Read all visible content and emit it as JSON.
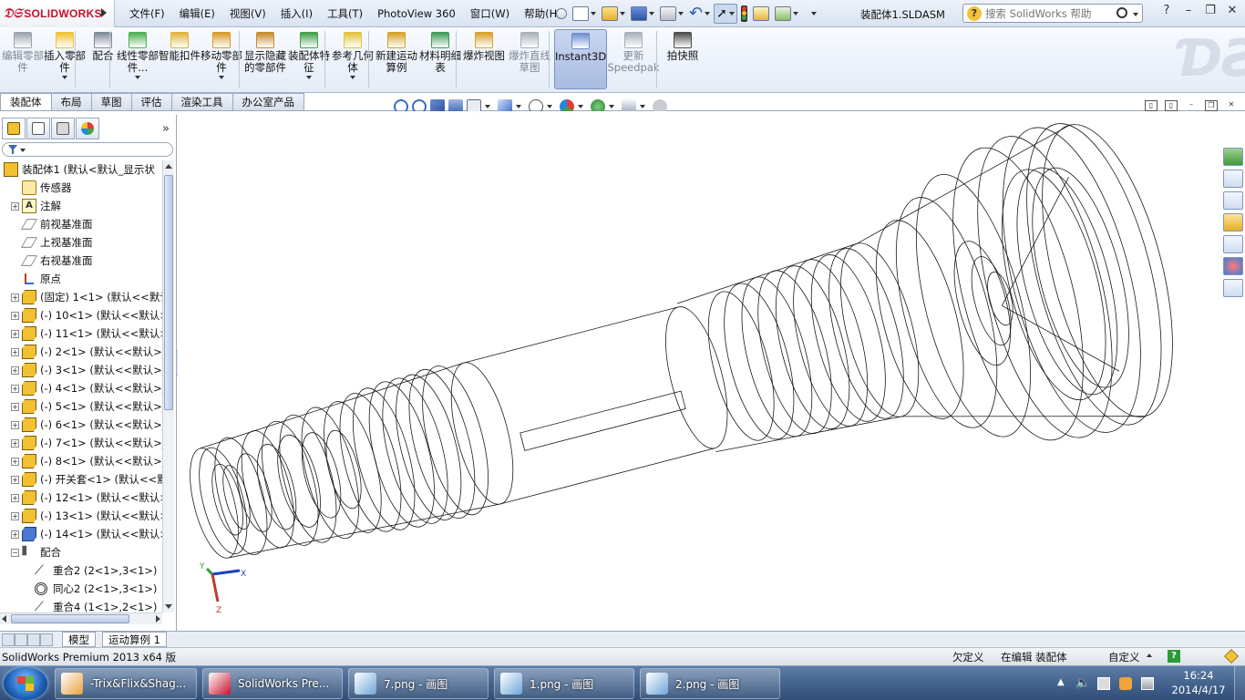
{
  "app": {
    "logo_text": "SOLIDWORKS",
    "doc_title": "装配体1.SLDASM"
  },
  "menu": [
    "文件(F)",
    "编辑(E)",
    "视图(V)",
    "插入(I)",
    "工具(T)",
    "PhotoView 360",
    "窗口(W)",
    "帮助(H)"
  ],
  "help_search": {
    "placeholder": "搜索 SolidWorks 帮助"
  },
  "ribbon": {
    "buttons": [
      {
        "label": "编辑零部件",
        "icon": "edit-component-icon",
        "color": "#9aa3ad",
        "disabled": true
      },
      {
        "label": "插入零部件",
        "icon": "insert-component-icon",
        "color": "#f2c131",
        "dropdown": true
      },
      {
        "label": "配合",
        "icon": "mate-icon",
        "color": "#7f8a99"
      },
      {
        "label": "线性零部件...",
        "icon": "linear-pattern-icon",
        "color": "#4caf50",
        "dropdown": true
      },
      {
        "label": "智能扣件",
        "icon": "smart-fasteners-icon",
        "color": "#e0b43a"
      },
      {
        "label": "移动零部件",
        "icon": "move-component-icon",
        "color": "#d89a2a",
        "dropdown": true
      },
      {
        "label": "显示隐藏的零部件",
        "icon": "show-hidden-icon",
        "color": "#c58b2b"
      },
      {
        "label": "装配体特征",
        "icon": "assembly-features-icon",
        "color": "#3f9f4a",
        "dropdown": true
      },
      {
        "label": "参考几何体",
        "icon": "reference-geometry-icon",
        "color": "#e3c23b",
        "dropdown": true
      },
      {
        "label": "新建运动算例",
        "icon": "motion-study-icon",
        "color": "#d6a024"
      },
      {
        "label": "材料明细表",
        "icon": "bom-icon",
        "color": "#3c9a55"
      },
      {
        "label": "爆炸视图",
        "icon": "exploded-view-icon",
        "color": "#d9a02a"
      },
      {
        "label": "爆炸直线草图",
        "icon": "explode-line-sketch-icon",
        "color": "#a7afb9",
        "disabled": true
      },
      {
        "label": "Instant3D",
        "icon": "instant3d-icon",
        "color": "#6d8fcf",
        "active": true
      },
      {
        "label": "更新Speedpak",
        "icon": "speedpak-icon",
        "color": "#a7afb9",
        "disabled": true
      },
      {
        "label": "拍快照",
        "icon": "snapshot-icon",
        "color": "#4b4b4b"
      }
    ]
  },
  "cm_tabs": [
    "装配体",
    "布局",
    "草图",
    "评估",
    "渲染工具",
    "办公室产品"
  ],
  "tree": {
    "rows": [
      {
        "indent": 0,
        "exp": "none",
        "icon": "asm",
        "text": "装配体1 (默认<默认_显示状"
      },
      {
        "indent": 1,
        "exp": "none",
        "icon": "sensor",
        "text": "传感器"
      },
      {
        "indent": 1,
        "exp": "+",
        "icon": "note",
        "text": "注解"
      },
      {
        "indent": 1,
        "exp": "none",
        "icon": "plane",
        "text": "前视基准面"
      },
      {
        "indent": 1,
        "exp": "none",
        "icon": "plane",
        "text": "上视基准面"
      },
      {
        "indent": 1,
        "exp": "none",
        "icon": "plane",
        "text": "右视基准面"
      },
      {
        "indent": 1,
        "exp": "none",
        "icon": "origin",
        "text": "原点"
      },
      {
        "indent": 1,
        "exp": "+",
        "icon": "part",
        "text": "(固定) 1<1> (默认<<默认"
      },
      {
        "indent": 1,
        "exp": "+",
        "icon": "part",
        "text": "(-) 10<1> (默认<<默认>"
      },
      {
        "indent": 1,
        "exp": "+",
        "icon": "part",
        "text": "(-) 11<1> (默认<<默认>"
      },
      {
        "indent": 1,
        "exp": "+",
        "icon": "part",
        "text": "(-) 2<1> (默认<<默认>_"
      },
      {
        "indent": 1,
        "exp": "+",
        "icon": "part",
        "text": "(-) 3<1> (默认<<默认>_"
      },
      {
        "indent": 1,
        "exp": "+",
        "icon": "part",
        "text": "(-) 4<1> (默认<<默认>_"
      },
      {
        "indent": 1,
        "exp": "+",
        "icon": "part",
        "text": "(-) 5<1> (默认<<默认>_"
      },
      {
        "indent": 1,
        "exp": "+",
        "icon": "part",
        "text": "(-) 6<1> (默认<<默认>_"
      },
      {
        "indent": 1,
        "exp": "+",
        "icon": "part",
        "text": "(-) 7<1> (默认<<默认>_"
      },
      {
        "indent": 1,
        "exp": "+",
        "icon": "part",
        "text": "(-) 8<1> (默认<<默认>_"
      },
      {
        "indent": 1,
        "exp": "+",
        "icon": "part",
        "text": "(-) 开关套<1> (默认<<默"
      },
      {
        "indent": 1,
        "exp": "+",
        "icon": "part",
        "text": "(-) 12<1> (默认<<默认>"
      },
      {
        "indent": 1,
        "exp": "+",
        "icon": "part",
        "text": "(-) 13<1> (默认<<默认>"
      },
      {
        "indent": 1,
        "exp": "+",
        "icon": "part-blue",
        "text": "(-) 14<1> (默认<<默认>"
      },
      {
        "indent": 1,
        "exp": "-",
        "icon": "mates",
        "text": "配合"
      },
      {
        "indent": 2,
        "exp": "none",
        "icon": "coincident",
        "text": "重合2 (2<1>,3<1>)"
      },
      {
        "indent": 2,
        "exp": "none",
        "icon": "concentric",
        "text": "同心2 (2<1>,3<1>)"
      },
      {
        "indent": 2,
        "exp": "none",
        "icon": "coincident",
        "text": "重合4 (1<1>,2<1>)"
      }
    ]
  },
  "bottom_tabs": [
    "模型",
    "运动算例 1"
  ],
  "status": {
    "product": "SolidWorks Premium 2013 x64 版",
    "state": "欠定义",
    "editing": "在编辑 装配体",
    "units": "自定义"
  },
  "triad": {
    "x": "X",
    "y": "Y",
    "z": "Z"
  },
  "taskbar": {
    "items": [
      {
        "label": "-Trix&Flix&Shag...",
        "icon": "keygen-icon",
        "color": "#e8a23a"
      },
      {
        "label": "SolidWorks Pre...",
        "icon": "solidworks-icon",
        "color": "#c8102e"
      },
      {
        "label": "7.png - 画图",
        "icon": "paint-icon",
        "color": "#6fa6d8"
      },
      {
        "label": "1.png - 画图",
        "icon": "paint-icon",
        "color": "#6fa6d8"
      },
      {
        "label": "2.png - 画图",
        "icon": "paint-icon",
        "color": "#6fa6d8"
      }
    ],
    "time": "16:24",
    "date": "2014/4/17"
  }
}
